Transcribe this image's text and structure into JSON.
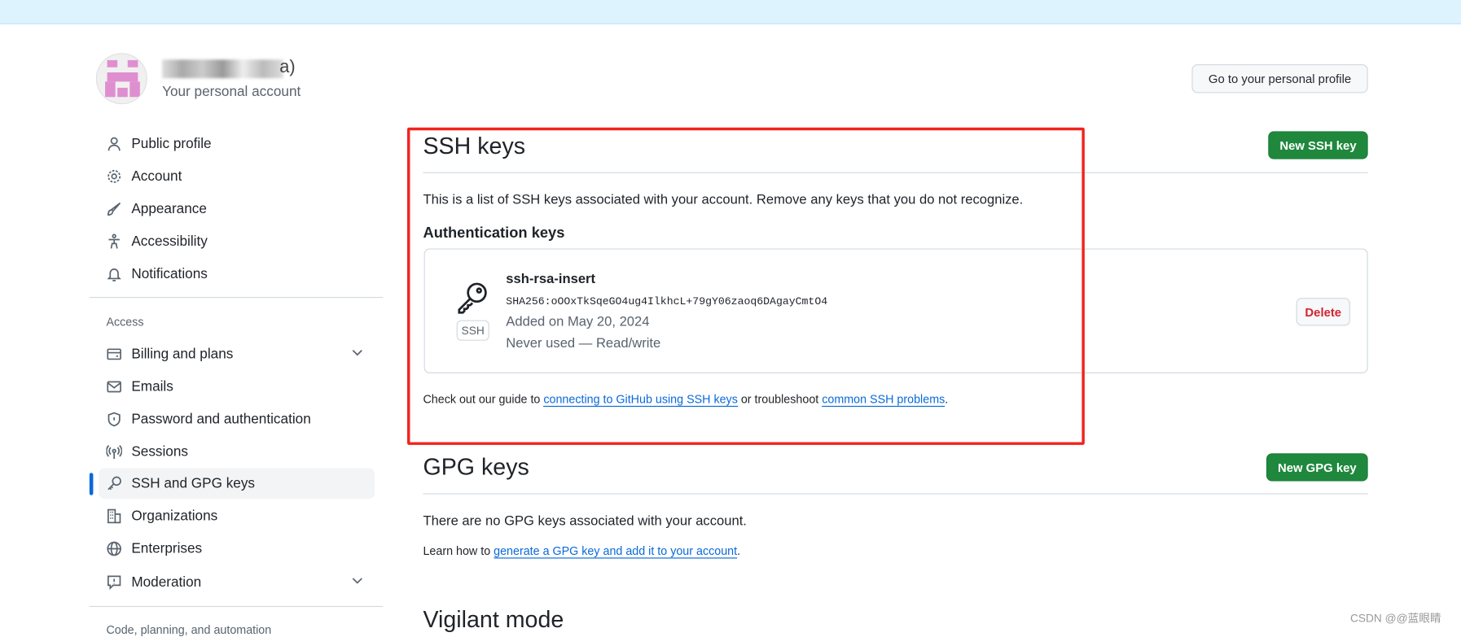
{
  "account": {
    "name_suffix": "a)",
    "subtitle": "Your personal account",
    "profile_button": "Go to your personal profile"
  },
  "sidebar": {
    "items": [
      {
        "label": "Public profile",
        "icon": "person-icon"
      },
      {
        "label": "Account",
        "icon": "gear-icon"
      },
      {
        "label": "Appearance",
        "icon": "paintbrush-icon"
      },
      {
        "label": "Accessibility",
        "icon": "accessibility-icon"
      },
      {
        "label": "Notifications",
        "icon": "bell-icon"
      }
    ],
    "access_heading": "Access",
    "access_items": [
      {
        "label": "Billing and plans",
        "icon": "credit-card-icon"
      },
      {
        "label": "Emails",
        "icon": "mail-icon"
      },
      {
        "label": "Password and authentication",
        "icon": "shield-icon"
      },
      {
        "label": "Sessions",
        "icon": "broadcast-icon"
      },
      {
        "label": "SSH and GPG keys",
        "icon": "key-icon",
        "selected": true
      },
      {
        "label": "Organizations",
        "icon": "organization-icon"
      },
      {
        "label": "Enterprises",
        "icon": "globe-icon"
      },
      {
        "label": "Moderation",
        "icon": "report-icon"
      }
    ],
    "next_heading": "Code, planning, and automation"
  },
  "ssh": {
    "title": "SSH keys",
    "new_button": "New SSH key",
    "description": "This is a list of SSH keys associated with your account. Remove any keys that you do not recognize.",
    "auth_heading": "Authentication keys",
    "key": {
      "badge": "SSH",
      "name": "ssh-rsa-insert",
      "fingerprint": "SHA256:oOOxTkSqeGO4ug4IlkhcL+79gY06zaoq6DAgayCmtO4",
      "added": "Added on May 20, 2024",
      "usage": "Never used — Read/write",
      "delete": "Delete"
    },
    "guide_pre": "Check out our guide to ",
    "guide_link1": "connecting to GitHub using SSH keys",
    "guide_mid": " or troubleshoot ",
    "guide_link2": "common SSH problems",
    "guide_end": "."
  },
  "gpg": {
    "title": "GPG keys",
    "new_button": "New GPG key",
    "empty": "There are no GPG keys associated with your account.",
    "learn_pre": "Learn how to ",
    "learn_link": "generate a GPG key and add it to your account",
    "learn_end": "."
  },
  "vigilant": {
    "title": "Vigilant mode"
  },
  "watermark": "CSDN @@蓝眼睛",
  "colors": {
    "accent": "#0969da",
    "green": "#1f883d",
    "highlight": "#f0231d",
    "banner": "#ddf4ff"
  }
}
